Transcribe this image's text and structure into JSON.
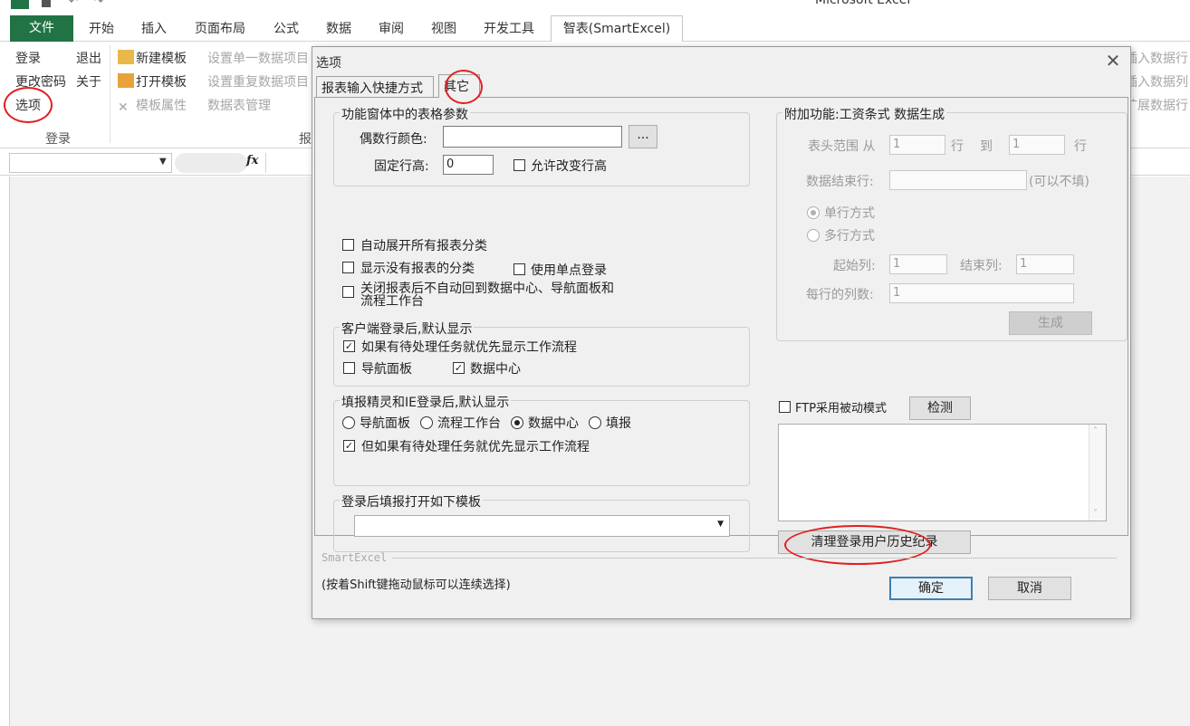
{
  "app": {
    "title": "Microsoft Excel"
  },
  "ribbon_tabs": [
    "文件",
    "开始",
    "插入",
    "页面布局",
    "公式",
    "数据",
    "审阅",
    "视图",
    "开发工具",
    "智表(SmartExcel)"
  ],
  "ribbon": {
    "login": "登录",
    "logout": "退出",
    "change_password": "更改密码",
    "about": "关于",
    "options": "选项",
    "group_login": "登录",
    "new_template": "新建模板",
    "open_template": "打开模板",
    "template_props": "模板属性",
    "set_single": "设置单一数据项目",
    "set_repeat": "设置重复数据项目",
    "data_table_mgmt": "数据表管理",
    "group_report": "报",
    "right1": "插入数据行",
    "right2": "插入数据列",
    "right3": "扩展数据行"
  },
  "formula": {
    "fx": "fx"
  },
  "dialog": {
    "title": "选项",
    "tabs": [
      "报表输入快捷方式",
      "其它"
    ],
    "func_group": {
      "title": "功能窗体中的表格参数",
      "even_row_color_label": "偶数行颜色:",
      "even_row_color_value": "",
      "browse_btn": "...",
      "fixed_row_height_label": "固定行高:",
      "fixed_row_height_value": "0",
      "allow_change_height": "允许改变行高"
    },
    "checks": {
      "auto_expand": "自动展开所有报表分类",
      "show_empty": "显示没有报表的分类",
      "single_sign": "使用单点登录",
      "close_no_return_1": "关闭报表后不自动回到数据中心、导航面板和",
      "close_no_return_2": "流程工作台"
    },
    "client_group": {
      "title": "客户端登录后,默认显示",
      "pending_first": "如果有待处理任务就优先显示工作流程",
      "nav_panel": "导航面板",
      "data_center": "数据中心"
    },
    "ie_group": {
      "title": "填报精灵和IE登录后,默认显示",
      "nav_panel": "导航面板",
      "workflow": "流程工作台",
      "data_center": "数据中心",
      "fill": "填报",
      "pending_first": "但如果有待处理任务就优先显示工作流程"
    },
    "template_group": {
      "title": "登录后填报打开如下模板",
      "selected": ""
    },
    "addon_group": {
      "title": "附加功能:工资条式 数据生成",
      "header_range": "表头范围 从",
      "from_value": "1",
      "row1": "行",
      "to": "到",
      "to_value": "1",
      "row2": "行",
      "data_end_row": "数据结束行:",
      "data_end_value": "",
      "optional": "(可以不填)",
      "single_mode": "单行方式",
      "multi_mode": "多行方式",
      "start_col": "起始列:",
      "start_col_value": "1",
      "end_col": "结束列:",
      "end_col_value": "1",
      "cols_per_row": "每行的列数:",
      "cols_per_row_value": "1",
      "generate": "生成"
    },
    "ftp": {
      "passive_mode": "FTP采用被动模式",
      "check_btn": "检测",
      "log_text": ""
    },
    "clear_history": "清理登录用户历史纪录",
    "footer": {
      "brand": "SmartExcel",
      "hint": "(按着Shift键拖动鼠标可以连续选择)",
      "ok": "确定",
      "cancel": "取消"
    }
  },
  "colors": {
    "file_tab": "#217346",
    "annotation": "#e02020"
  }
}
